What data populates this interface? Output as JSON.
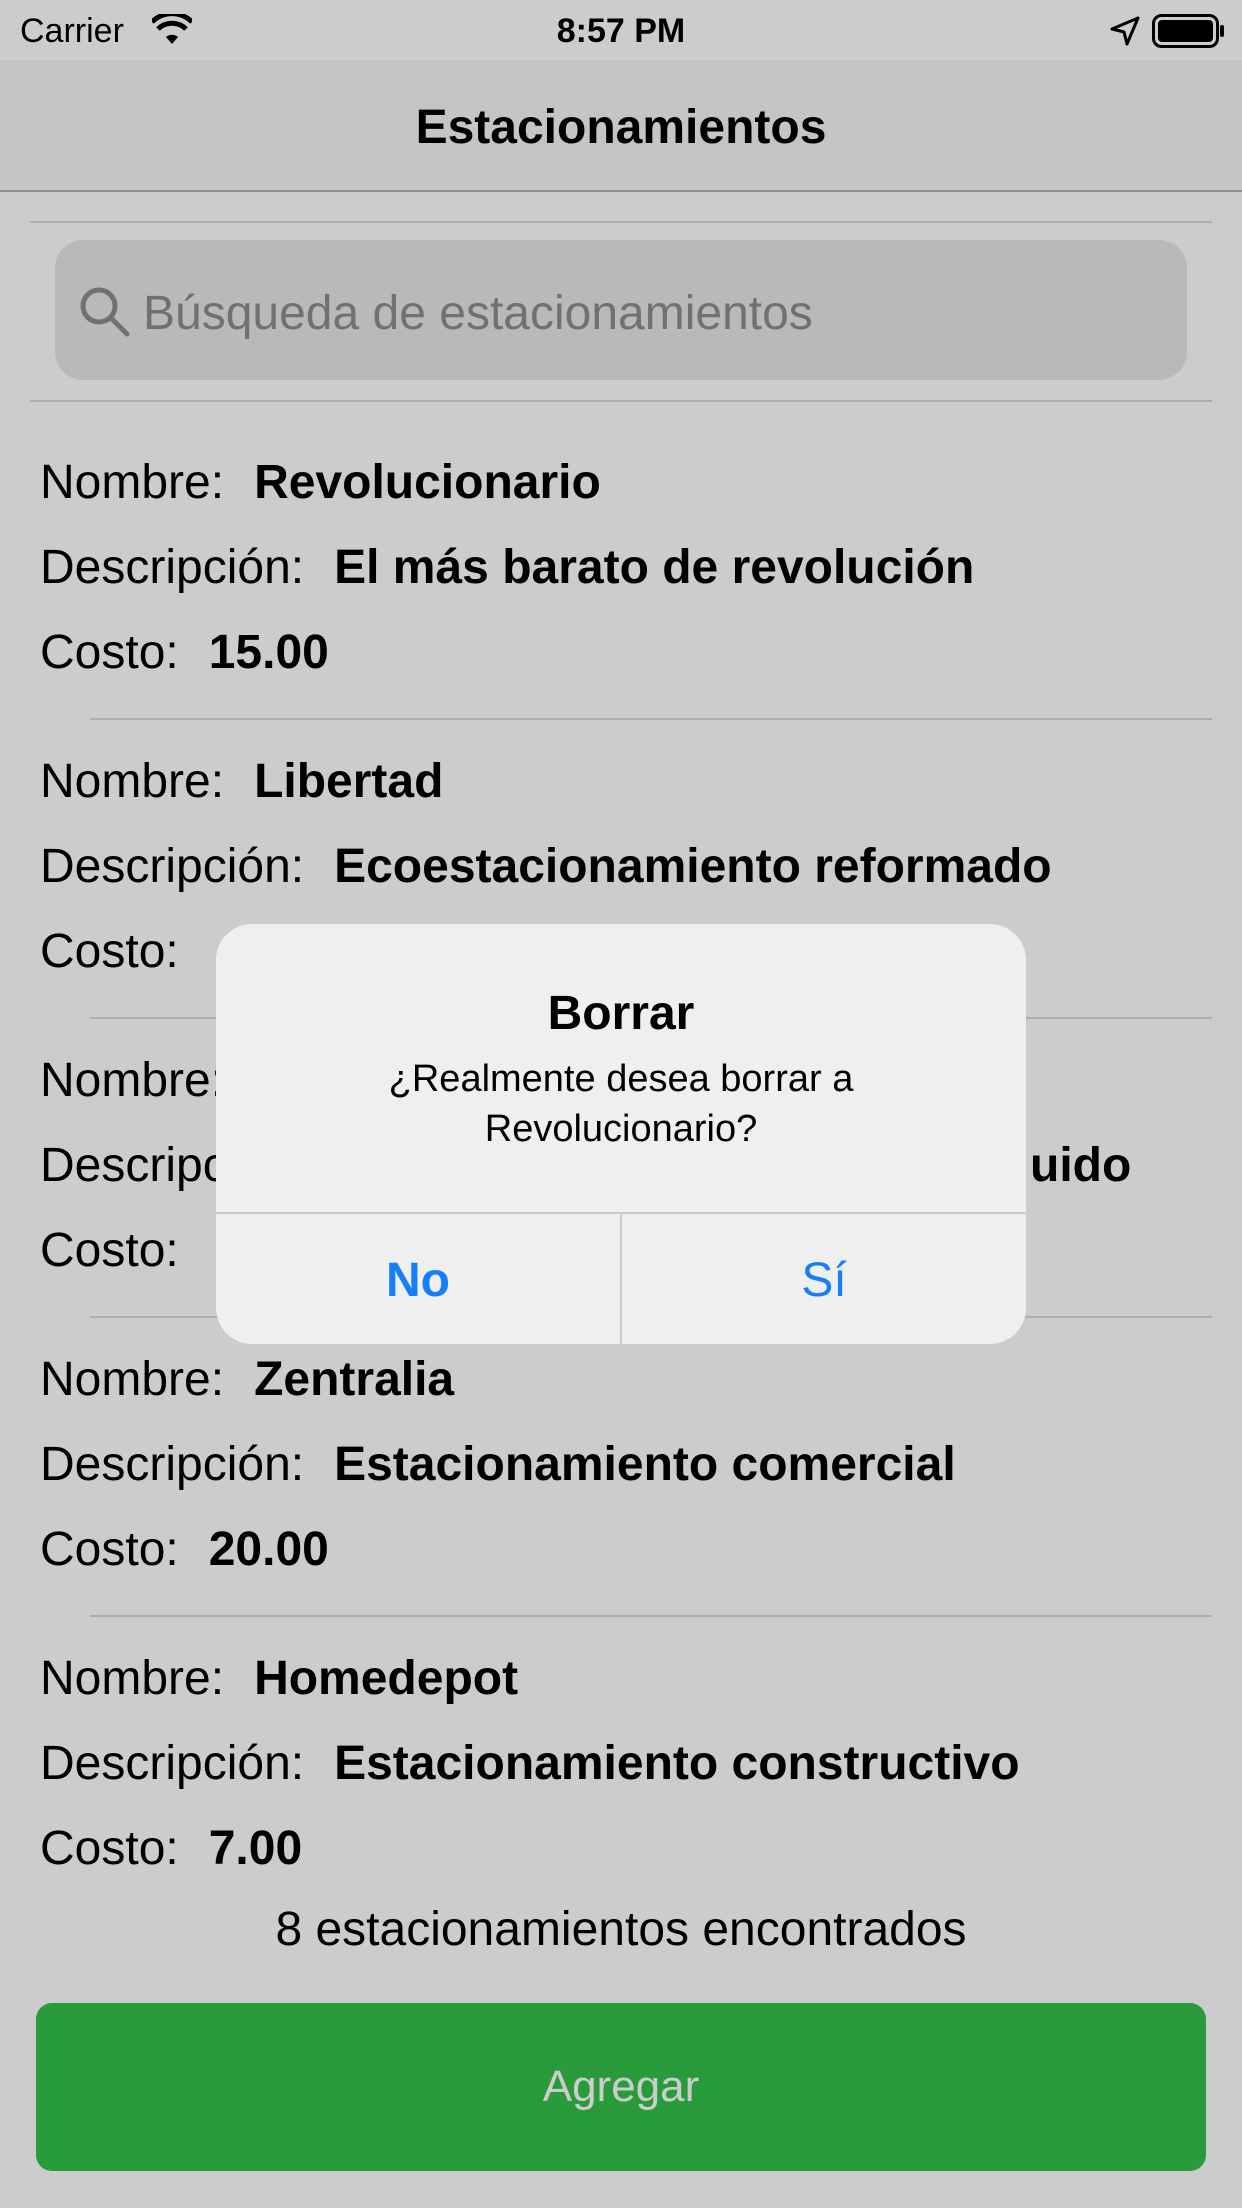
{
  "status_bar": {
    "carrier": "Carrier",
    "time": "8:57 PM",
    "icons": [
      "wifi-icon",
      "location-arrow-icon",
      "battery-icon"
    ]
  },
  "nav": {
    "title": "Estacionamientos"
  },
  "search": {
    "placeholder": "Búsqueda de estacionamientos",
    "icon": "search-icon"
  },
  "labels": {
    "name": "Nombre:",
    "description": "Descripción:",
    "cost": "Costo:"
  },
  "parkings": [
    {
      "name": "Revolucionario",
      "description": "El más barato de revolución",
      "cost": "15.00"
    },
    {
      "name": "Libertad",
      "description": "Ecoestacionamiento reformado",
      "cost": ""
    },
    {
      "name": "",
      "description": "uido",
      "cost": ""
    },
    {
      "name": "Zentralia",
      "description": "Estacionamiento comercial",
      "cost": "20.00"
    },
    {
      "name": "Homedepot",
      "description": "Estacionamiento constructivo",
      "cost": "7.00"
    }
  ],
  "count_text": "8 estacionamientos encontrados",
  "add_button": {
    "label": "Agregar",
    "color": "#34c24a"
  },
  "alert": {
    "title": "Borrar",
    "message": "¿Realmente desea borrar a Revolucionario?",
    "cancel_label": "No",
    "confirm_label": "Sí",
    "button_color": "#147efb"
  }
}
